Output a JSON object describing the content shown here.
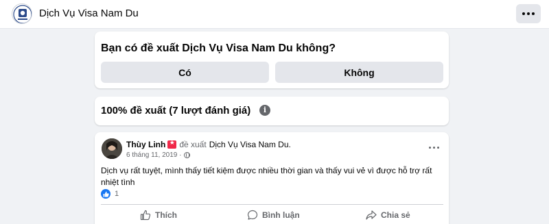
{
  "header": {
    "page_name": "Dịch Vụ Visa Nam Du",
    "logo_icon": "page-logo-icon",
    "more_icon": "more-horizontal-icon"
  },
  "recommend": {
    "question": "Bạn có đề xuất Dịch Vụ Visa Nam Du không?",
    "yes_label": "Có",
    "no_label": "Không"
  },
  "score": {
    "summary": "100% đề xuất (7 lượt đánh giá)",
    "info_icon": "info-icon"
  },
  "review": {
    "reviewer": "Thùy Linh",
    "recommend_word": "đề xuất",
    "page_name": "Dịch Vụ Visa Nam Du",
    "dot": ".",
    "date": "6 tháng 11, 2019 ·",
    "text": "Dịch vụ rất tuyệt, mình thấy tiết kiệm được nhiều thời gian và thấy vui vẻ vì được hỗ trợ rất nhiệt tình",
    "like_count": "1",
    "actions": {
      "like": "Thích",
      "comment": "Bình luận",
      "share": "Chia sẻ"
    }
  },
  "colors": {
    "accent_blue": "#1877f2",
    "recommend_red": "#f02849",
    "secondary_text": "#65676b",
    "button_gray": "#e4e6eb"
  }
}
